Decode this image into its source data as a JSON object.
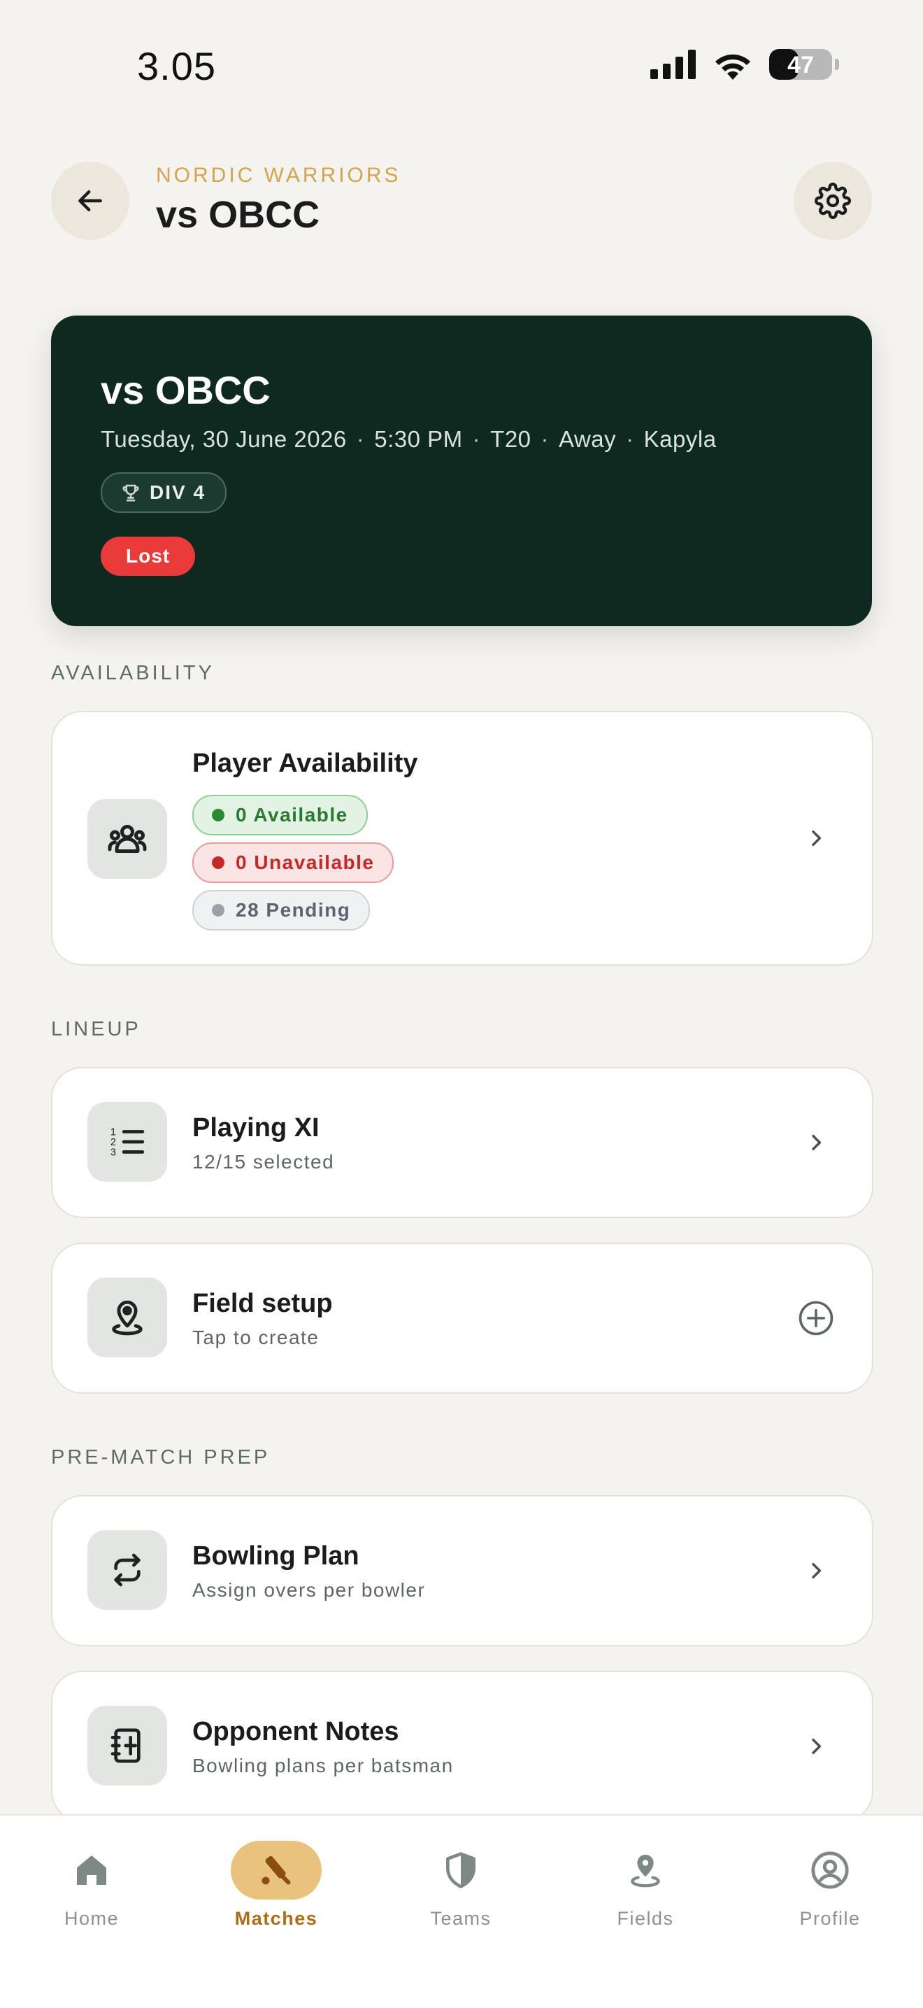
{
  "status_bar": {
    "time": "3.05",
    "battery": "47",
    "battery_level": 0.47
  },
  "header": {
    "team_name": "NORDIC WARRIORS",
    "title": "vs OBCC"
  },
  "match": {
    "title": "vs OBCC",
    "date": "Tuesday, 30 June 2026",
    "time": "5:30 PM",
    "format": "T20",
    "venue_type": "Away",
    "location": "Kapyla",
    "separator": "·",
    "division": "DIV 4",
    "result": "Lost",
    "result_color": "#ea3b3b"
  },
  "sections": {
    "availability": "AVAILABILITY",
    "lineup": "LINEUP",
    "prep": "PRE-MATCH PREP"
  },
  "availability_card": {
    "title": "Player Availability",
    "available": "0 Available",
    "unavailable": "0 Unavailable",
    "pending": "28 Pending"
  },
  "playing_xi": {
    "title": "Playing XI",
    "subtitle": "12/15 selected"
  },
  "field_setup": {
    "title": "Field setup",
    "subtitle": "Tap to create"
  },
  "bowling_plan": {
    "title": "Bowling Plan",
    "subtitle": "Assign overs per bowler"
  },
  "opponent_notes": {
    "title": "Opponent Notes",
    "subtitle": "Bowling plans per batsman"
  },
  "nav": {
    "home": "Home",
    "matches": "Matches",
    "teams": "Teams",
    "fields": "Fields",
    "profile": "Profile",
    "active": "Matches"
  },
  "colors": {
    "accent": "#d4a44a",
    "hero_bg": "#0e2a20",
    "active_nav": "#e9c27e"
  }
}
